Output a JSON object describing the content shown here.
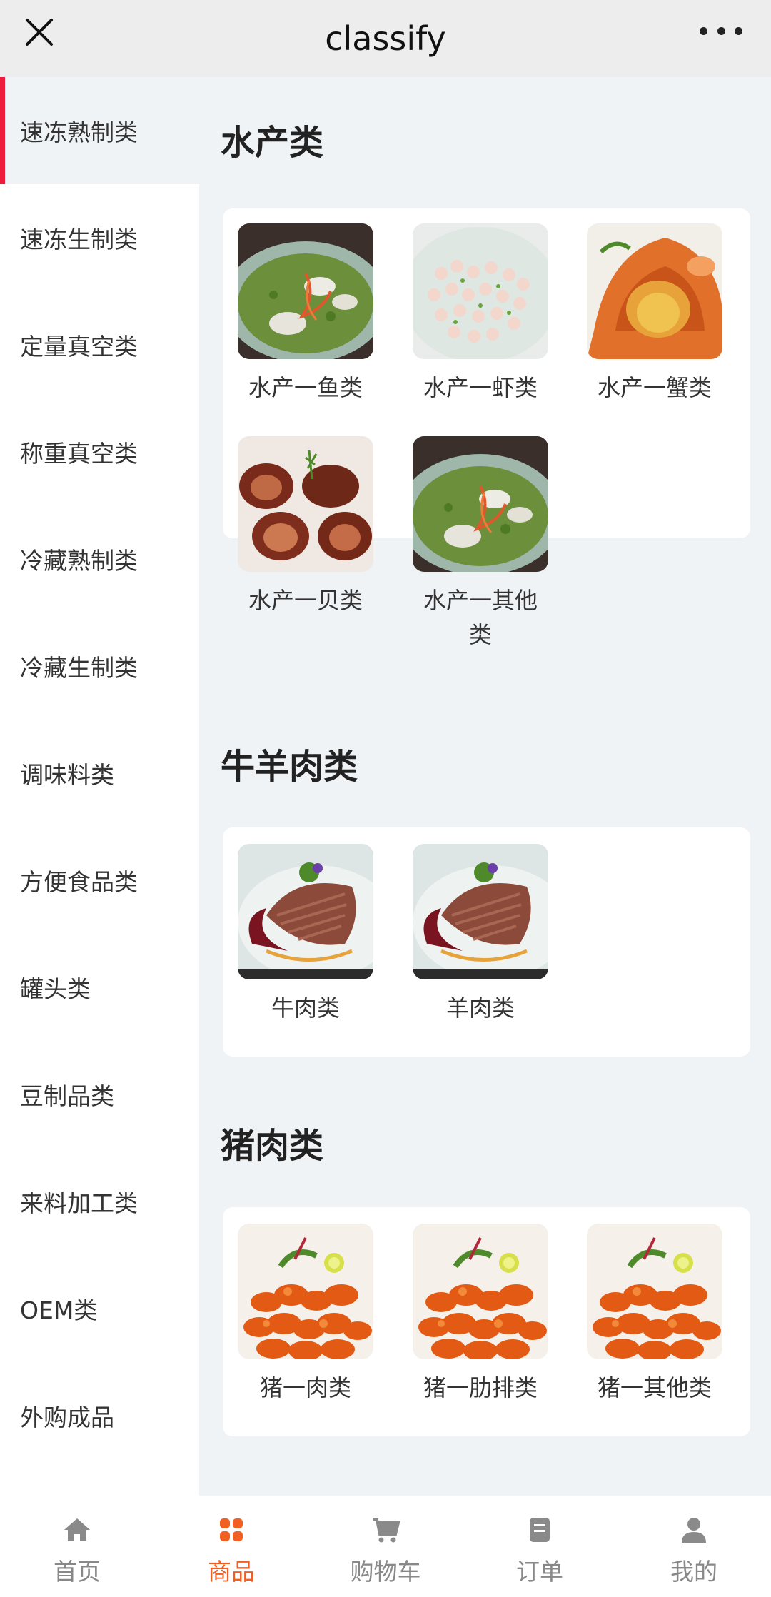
{
  "header": {
    "title": "classify",
    "close_icon": "close-icon",
    "more_icon": "more-icon"
  },
  "sidebar": {
    "items": [
      {
        "label": "速冻熟制类",
        "active": true
      },
      {
        "label": "速冻生制类"
      },
      {
        "label": "定量真空类"
      },
      {
        "label": "称重真空类"
      },
      {
        "label": "冷藏熟制类"
      },
      {
        "label": "冷藏生制类"
      },
      {
        "label": "调味料类"
      },
      {
        "label": "方便食品类"
      },
      {
        "label": "罐头类"
      },
      {
        "label": "豆制品类"
      },
      {
        "label": "来料加工类"
      },
      {
        "label": "OEM类"
      },
      {
        "label": "外购成品"
      }
    ]
  },
  "sections": [
    {
      "title": "水产类",
      "items": [
        {
          "label": "水产一鱼类",
          "image": "fish-dish"
        },
        {
          "label": "水产一虾类",
          "image": "shrimp-dish"
        },
        {
          "label": "水产一蟹类",
          "image": "crab-dish"
        },
        {
          "label": "水产一贝类",
          "image": "abalone-dish"
        },
        {
          "label": "水产一其他类",
          "image": "fish-dish"
        }
      ]
    },
    {
      "title": "牛羊肉类",
      "items": [
        {
          "label": "牛肉类",
          "image": "meat-dish"
        },
        {
          "label": "羊肉类",
          "image": "meat-dish"
        }
      ]
    },
    {
      "title": "猪肉类",
      "items": [
        {
          "label": "猪一肉类",
          "image": "pork-dish"
        },
        {
          "label": "猪一肋排类",
          "image": "pork-dish"
        },
        {
          "label": "猪一其他类",
          "image": "pork-dish"
        }
      ]
    }
  ],
  "tabbar": {
    "tabs": [
      {
        "label": "首页",
        "icon": "home-icon"
      },
      {
        "label": "商品",
        "icon": "grid-icon",
        "active": true
      },
      {
        "label": "购物车",
        "icon": "cart-icon"
      },
      {
        "label": "订单",
        "icon": "order-icon"
      },
      {
        "label": "我的",
        "icon": "user-icon"
      }
    ]
  },
  "colors": {
    "accent_red": "#ee1c3a",
    "accent_orange": "#f25f22",
    "page_bg": "#f0f3f6"
  }
}
